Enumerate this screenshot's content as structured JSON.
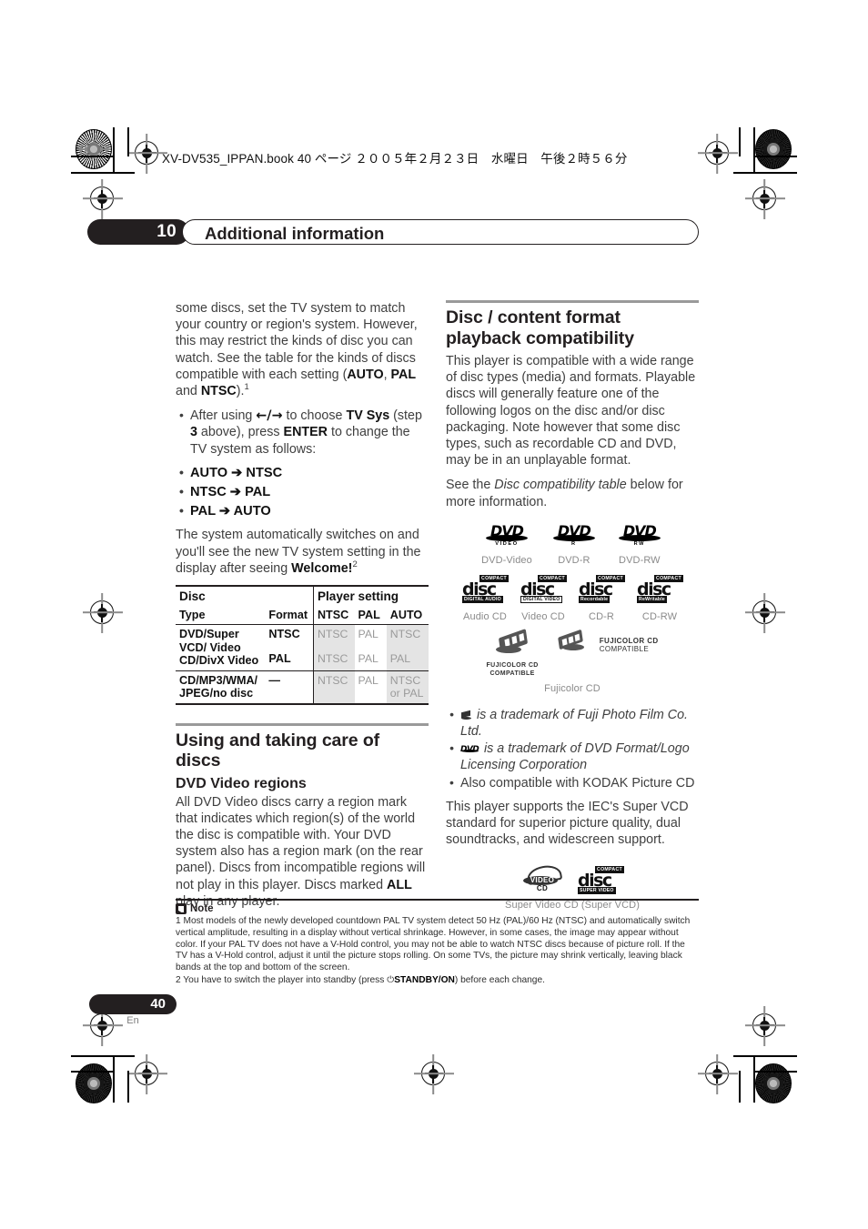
{
  "header": {
    "book_line": "XV-DV535_IPPAN.book  40 ページ  ２００５年２月２３日　水曜日　午後２時５６分"
  },
  "chapter": {
    "number": "10",
    "title": "Additional information"
  },
  "left_column": {
    "intro_paragraph": "some discs, set the TV system to match your country or region's system. However, this may restrict the kinds of disc you can watch. See the table for the kinds of discs compatible with each setting (",
    "intro_bold_1": "AUTO",
    "intro_mid_1": ", ",
    "intro_bold_2": "PAL",
    "intro_mid_2": " and ",
    "intro_bold_3": "NTSC",
    "intro_tail": ").",
    "intro_footnote_ref": "1",
    "bullet_step": {
      "pre": "After using ",
      "arrows": "←/→",
      "mid": " to choose ",
      "bold_1": "TV Sys",
      "mid2": " (step ",
      "bold_2": "3",
      "mid3": " above), press ",
      "bold_3": "ENTER",
      "tail": " to change the TV system as follows:"
    },
    "transitions": [
      "AUTO ➔ NTSC",
      "NTSC ➔ PAL",
      "PAL ➔ AUTO"
    ],
    "after_paragraph": "The system automatically switches on and you'll see the new TV system setting in the display after seeing ",
    "after_bold": "Welcome!",
    "after_footnote_ref": "2",
    "section_heading": "Using and taking care of discs",
    "sub_heading": "DVD Video regions",
    "region_paragraph_pre": "All DVD Video discs carry a region mark that indicates which region(s) of the world the disc is compatible with. Your DVD system also has a region mark (on the rear panel). Discs from incompatible regions will not play in this player. Discs marked ",
    "region_bold": "ALL",
    "region_paragraph_post": " play in any player."
  },
  "tv_table": {
    "group_header_disc": "Disc",
    "group_header_player": "Player setting",
    "columns": [
      "Type",
      "Format",
      "NTSC",
      "PAL",
      "AUTO"
    ],
    "rows": [
      {
        "type": "DVD/Super VCD/ Video CD/DivX Video",
        "format": "NTSC",
        "ntsc": "NTSC",
        "pal": "PAL",
        "auto": "NTSC"
      },
      {
        "type": "",
        "format": "PAL",
        "ntsc": "NTSC",
        "pal": "PAL",
        "auto": "PAL"
      },
      {
        "type": "CD/MP3/WMA/ JPEG/no disc",
        "format": "—",
        "ntsc": "NTSC",
        "pal": "PAL",
        "auto": "NTSC or PAL"
      }
    ],
    "shade_color": "#e4e4e4"
  },
  "right_column": {
    "section_heading": "Disc / content format playback compatibility",
    "paragraph_1": "This player is compatible with a wide range of disc types (media) and formats. Playable discs will generally feature one of the following logos on the disc and/or disc packaging. Note however that some disc types, such as recordable CD and DVD, may be in an unplayable format.",
    "paragraph_2_pre": "See the ",
    "paragraph_2_italic": "Disc compatibility table",
    "paragraph_2_post": " below for more information.",
    "logo_rows": [
      {
        "items": [
          {
            "icon": "dvd-video-logo",
            "mark": "DVD",
            "sub": "VIDEO",
            "caption": "DVD-Video"
          },
          {
            "icon": "dvd-r-logo",
            "mark": "DVD",
            "sub": "R",
            "caption": "DVD-R"
          },
          {
            "icon": "dvd-rw-logo",
            "mark": "DVD",
            "sub": "RW",
            "caption": "DVD-RW"
          }
        ]
      },
      {
        "items": [
          {
            "icon": "audio-cd-logo",
            "mark": "disc",
            "top": "COMPACT",
            "sub": "DIGITAL AUDIO",
            "caption": "Audio CD"
          },
          {
            "icon": "video-cd-logo",
            "mark": "disc",
            "top": "COMPACT",
            "sub": "DIGITAL VIDEO",
            "caption": "Video CD"
          },
          {
            "icon": "cd-r-logo",
            "mark": "disc",
            "top": "COMPACT",
            "sub": "Recordable",
            "caption": "CD-R"
          },
          {
            "icon": "cd-rw-logo",
            "mark": "disc",
            "top": "COMPACT",
            "sub": "ReWritable",
            "caption": "CD-RW"
          }
        ]
      }
    ],
    "fujicolor": {
      "logo_1_line_1": "FUJICOLOR CD",
      "logo_1_line_2": "COMPATIBLE",
      "logo_2_line_1": "FUJICOLOR CD",
      "logo_2_line_2": "COMPATIBLE",
      "caption": "Fujicolor CD"
    },
    "trademarks": [
      {
        "icon": "fuji-mark-icon",
        "text": "is a trademark of Fuji Photo Film Co. Ltd."
      },
      {
        "icon": "dvd-mark-icon",
        "text": "is a trademark of DVD Format/Logo Licensing Corporation"
      },
      {
        "icon": "",
        "text": "Also compatible with KODAK Picture CD"
      }
    ],
    "svcd_paragraph": "This player supports the IEC's Super VCD standard for superior picture quality, dual soundtracks, and widescreen support.",
    "svcd_logo": {
      "video_text": "VIDEO",
      "cd_text": "CD",
      "disc_text": "disc",
      "disc_top": "COMPACT",
      "disc_sub": "SUPER VIDEO",
      "caption": "Super Video CD (Super VCD)"
    }
  },
  "note": {
    "title": "Note",
    "items": [
      "1 Most models of the newly developed countdown PAL TV system detect 50 Hz (PAL)/60 Hz (NTSC) and automatically switch vertical amplitude, resulting in a display without vertical shrinkage. However, in some cases, the image may appear without color. If your PAL TV does not have a V-Hold control, you may not be able to watch NTSC discs because of picture roll. If the TV has a V-Hold control, adjust it until the picture stops rolling. On some TVs, the picture may shrink vertically, leaving black bands at the top and bottom of the screen."
    ],
    "item2_pre": "2 You have to switch the player into standby (press ",
    "item2_symbol": "⏻",
    "item2_bold": "STANDBY/ON",
    "item2_post": ") before each change."
  },
  "footer": {
    "page_number": "40",
    "language": "En"
  }
}
